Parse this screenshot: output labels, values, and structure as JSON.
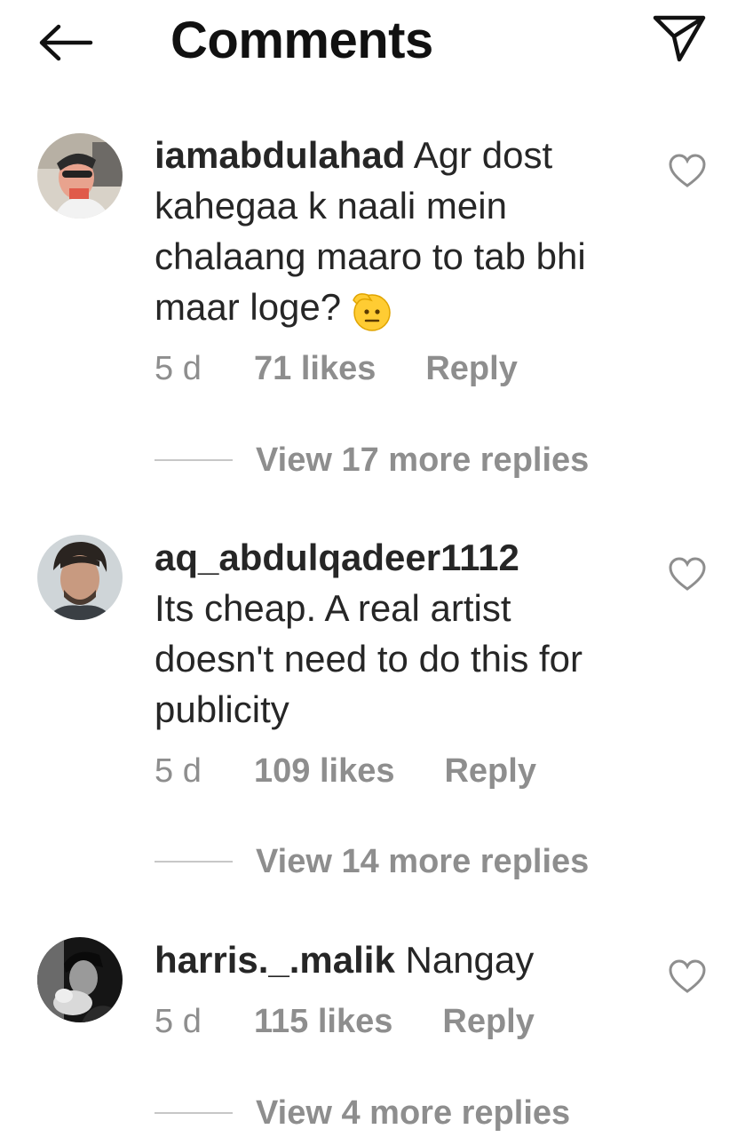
{
  "header": {
    "title": "Comments",
    "back_icon": "arrow-left-icon",
    "share_icon": "paper-plane-icon"
  },
  "comments": [
    {
      "username": "iamabdulahad",
      "text": "Agr dost kahegaa k naali mein chalaang maaro to tab bhi maar loge?",
      "emoji": "saluting-face-emoji",
      "time": "5 d",
      "likes": "71 likes",
      "reply": "Reply",
      "view_replies": "View 17 more replies"
    },
    {
      "username": "aq_abdulqadeer1112",
      "text": "Its cheap. A real artist doesn't need to do this for publicity",
      "time": "5 d",
      "likes": "109 likes",
      "reply": "Reply",
      "view_replies": "View 14 more replies"
    },
    {
      "username": "harris._.malik",
      "text": "Nangay",
      "time": "5 d",
      "likes": "115 likes",
      "reply": "Reply",
      "view_replies": "View 4 more replies"
    }
  ],
  "colors": {
    "text_primary": "#262626",
    "text_secondary": "#8e8e8e",
    "divider": "#c7c7c7"
  }
}
